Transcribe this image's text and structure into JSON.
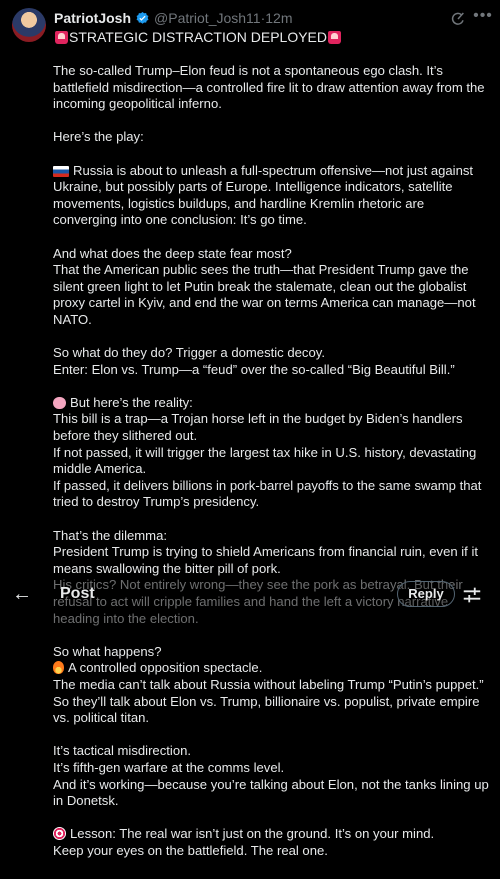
{
  "post": {
    "author_name": "PatriotJosh",
    "author_handle": "@Patriot_Josh11",
    "separator": " · ",
    "time": "12m",
    "headline": "STRATEGIC DISTRACTION DEPLOYED"
  },
  "nav": {
    "title": "Post",
    "reply_label": "Reply"
  },
  "icons": {
    "verified": "verified-badge-icon",
    "grok": "grok-icon",
    "more": "more-icon",
    "back": "back-arrow-icon",
    "settings": "tune-icon"
  },
  "colors": {
    "background": "#000000",
    "text": "#e7e9ea",
    "muted": "#71767b",
    "verified": "#1d9bf0"
  },
  "body": {
    "p1": "The so-called Trump–Elon feud is not a spontaneous ego clash. It’s battlefield misdirection—a controlled fire lit to draw attention away from the incoming geopolitical inferno.",
    "p2": "Here’s the play:",
    "p3": "Russia is about to unleash a full-spectrum offensive—not just against Ukraine, but possibly parts of Europe. Intelligence indicators, satellite movements, logistics buildups, and hardline Kremlin rhetoric are converging into one conclusion: It’s go time.",
    "p4_l1": "And what does the deep state fear most?",
    "p4_l2": "That the American public sees the truth—that President Trump gave the silent green light to let Putin break the stalemate, clean out the globalist proxy cartel in Kyiv, and end the war on terms America can manage—not NATO.",
    "p5_l1": "So what do they do? Trigger a domestic decoy.",
    "p5_l2": "Enter: Elon vs. Trump—a “feud” over the so-called “Big Beautiful Bill.”",
    "p6_l1": "But here’s the reality:",
    "p6_l2": "This bill is a trap—a Trojan horse left in the budget by Biden’s handlers before they slithered out.",
    "p6_l3": "If not passed, it will trigger the largest tax hike in U.S. history, devastating middle America.",
    "p6_l4": "If passed, it delivers billions in pork-barrel payoffs to the same swamp that tried to destroy Trump’s presidency.",
    "p7_l1": "That’s the dilemma:",
    "p7_l2": "President Trump is trying to shield Americans from financial ruin, even if it means swallowing the bitter pill of pork.",
    "p7_l3": "His critics? Not entirely wrong—they see the pork as betrayal. But their refusal to act will cripple families and hand the left a victory narrative heading into the election.",
    "p8_l1": "So what happens?",
    "p8_l2": "A controlled opposition spectacle.",
    "p8_l3": "The media can’t talk about Russia without labeling Trump “Putin’s puppet.” So they’ll talk about Elon vs. Trump, billionaire vs. populist, private empire vs. political titan.",
    "p9_l1": "It’s tactical misdirection.",
    "p9_l2": "It’s fifth-gen warfare at the comms level.",
    "p9_l3": "And it’s working—because you’re talking about Elon, not the tanks lining up in Donetsk.",
    "p10_l1": "Lesson: The real war isn’t just on the ground. It’s on your mind.",
    "p10_l2": "Keep your eyes on the battlefield. The real one."
  }
}
